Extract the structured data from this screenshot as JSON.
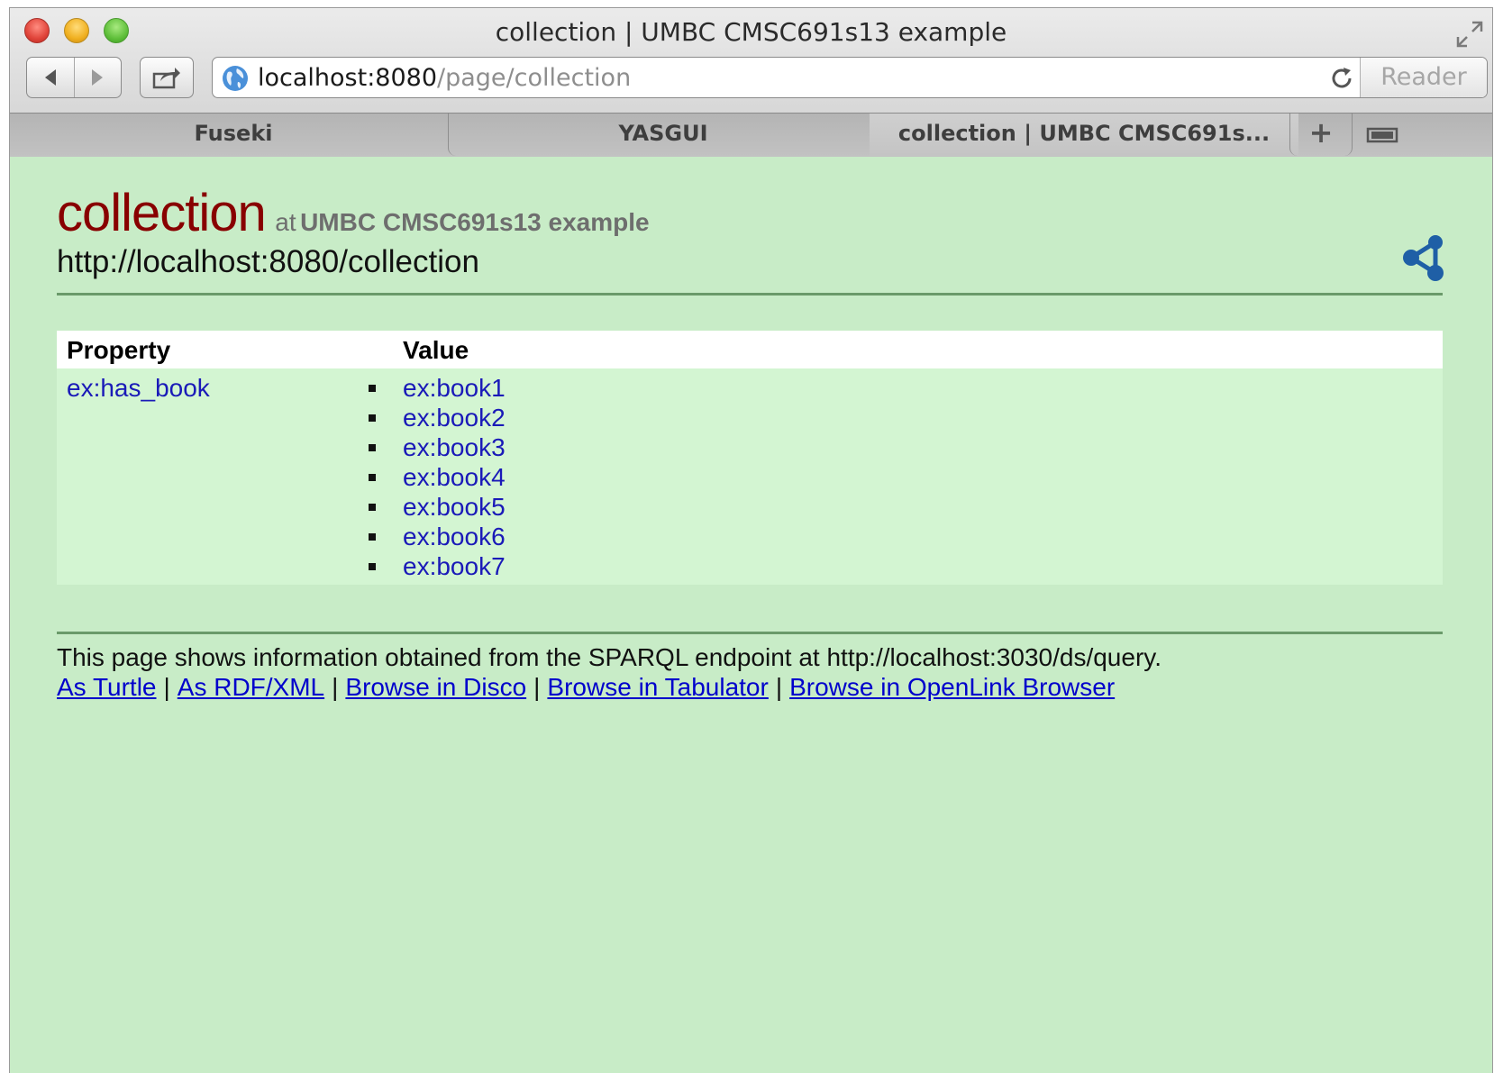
{
  "window": {
    "title": "collection | UMBC CMSC691s13 example"
  },
  "toolbar": {
    "url_host": "localhost:8080",
    "url_path": "/page/collection",
    "reader_label": "Reader"
  },
  "tabs": [
    {
      "label": "Fuseki"
    },
    {
      "label": "YASGUI"
    },
    {
      "label": "collection | UMBC CMSC691s..."
    }
  ],
  "page": {
    "title": "collection",
    "at": "at",
    "site_name": "UMBC CMSC691s13 example",
    "uri": "http://localhost:8080/collection"
  },
  "table": {
    "headers": {
      "property": "Property",
      "value": "Value"
    },
    "rows": [
      {
        "property": "ex:has_book",
        "values": [
          "ex:book1",
          "ex:book2",
          "ex:book3",
          "ex:book4",
          "ex:book5",
          "ex:book6",
          "ex:book7"
        ]
      }
    ]
  },
  "footer": {
    "text": "This page shows information obtained from the SPARQL endpoint at http://localhost:3030/ds/query.",
    "links": [
      "As Turtle",
      "As RDF/XML",
      "Browse in Disco",
      "Browse in Tabulator",
      "Browse in OpenLink Browser"
    ],
    "separator": "|"
  },
  "colors": {
    "page_background": "#c8ecc7",
    "title": "#880000",
    "link": "#1a1ab8",
    "footer_link": "#0000cc",
    "share_icon": "#1f5fa6"
  },
  "icons": {
    "close": "close-icon",
    "minimize": "minimize-icon",
    "zoom": "zoom-icon",
    "fullscreen": "fullscreen-icon",
    "back": "back-arrow-icon",
    "forward": "forward-arrow-icon",
    "share": "share-icon",
    "site": "globe-icon",
    "reload": "reload-icon",
    "new_tab": "plus-icon",
    "tab_overview": "tab-overview-icon",
    "rdf": "rdf-share-icon"
  }
}
